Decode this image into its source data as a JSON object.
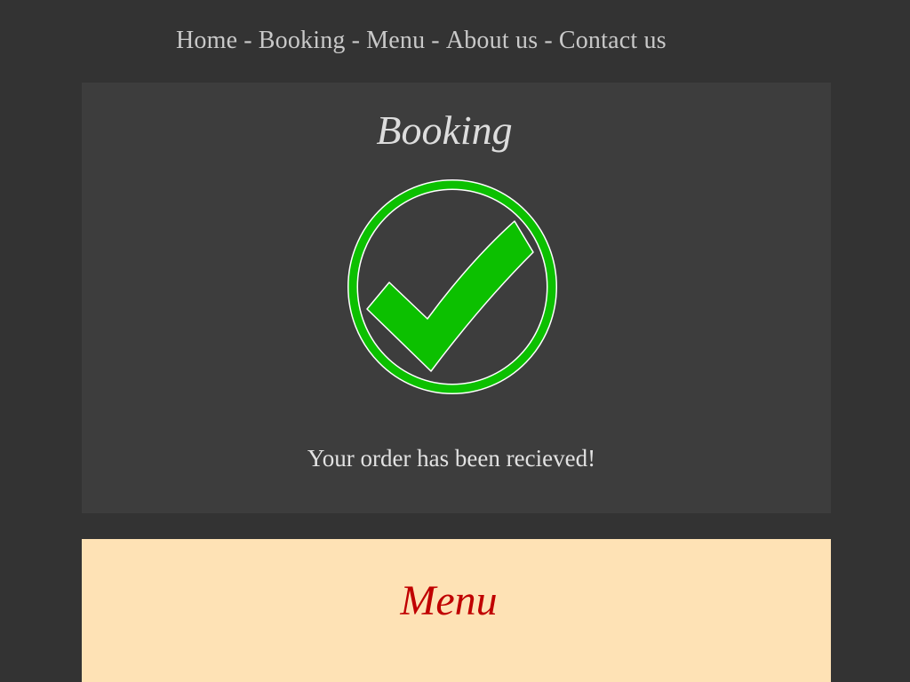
{
  "nav": {
    "items": [
      {
        "label": "Home"
      },
      {
        "label": "Booking"
      },
      {
        "label": "Menu"
      },
      {
        "label": "About us"
      },
      {
        "label": "Contact us"
      }
    ],
    "separator": "-"
  },
  "booking": {
    "title": "Booking",
    "icon": "checkmark-circle-icon",
    "message": "Your order has been recieved!"
  },
  "menu_section": {
    "title": "Menu"
  },
  "colors": {
    "background": "#333333",
    "booking_panel": "#3d3d3d",
    "menu_panel": "#fee2b5",
    "menu_title": "#c00000",
    "check_green": "#0cc000"
  }
}
